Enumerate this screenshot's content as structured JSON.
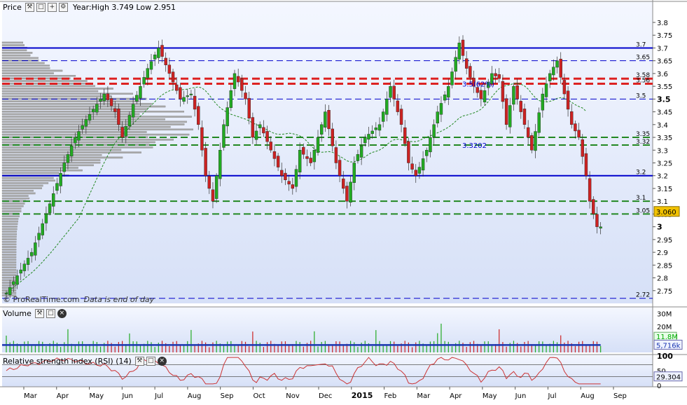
{
  "panels": {
    "price": {
      "title": "Price",
      "info": "Year:High 3.749 Low 2.951"
    },
    "volume": {
      "title": "Volume"
    },
    "rsi": {
      "title": "Relative strength index (RSI) (14)"
    }
  },
  "watermark": {
    "brand": "© ProRealTime.com",
    "note": "Data is end of day"
  },
  "icons": [
    "wrench-icon",
    "window-icon",
    "add-icon",
    "settings-icon",
    "close-icon"
  ],
  "colors": {
    "bull": "#22aa22",
    "bear": "#cc2222",
    "resistance": "#0000cc",
    "support": "#228822",
    "cluster": "#dd2222",
    "volume_ma": "#1a36b0",
    "rsi_line": "#cc3333",
    "last_price_bg": "#f2c200"
  },
  "chart_data": [
    {
      "type": "candlestick",
      "panel": "price",
      "x_labels": [
        "Mar",
        "Apr",
        "May",
        "Jun",
        "Jul",
        "Aug",
        "Sep",
        "Oct",
        "Nov",
        "Dec",
        "2015",
        "Feb",
        "Mar",
        "Apr",
        "May",
        "Jun",
        "Jul",
        "Aug",
        "Sep"
      ],
      "y_ticks": [
        2.75,
        2.8,
        2.85,
        2.9,
        2.95,
        3,
        3.05,
        3.1,
        3.15,
        3.2,
        3.25,
        3.3,
        3.35,
        3.4,
        3.45,
        3.5,
        3.55,
        3.6,
        3.65,
        3.7,
        3.75,
        3.8
      ],
      "ylim": [
        2.7,
        3.8
      ],
      "grid": false,
      "year_high": 3.749,
      "year_low": 2.951,
      "last_price": "3.060",
      "path_points": [
        [
          0,
          2.74
        ],
        [
          7,
          2.9
        ],
        [
          11,
          3.05
        ],
        [
          16,
          3.25
        ],
        [
          19,
          3.35
        ],
        [
          22,
          3.42
        ],
        [
          27,
          3.52
        ],
        [
          30,
          3.45
        ],
        [
          32,
          3.35
        ],
        [
          35,
          3.48
        ],
        [
          39,
          3.62
        ],
        [
          42,
          3.7
        ],
        [
          45,
          3.6
        ],
        [
          48,
          3.5
        ],
        [
          51,
          3.52
        ],
        [
          53,
          3.4
        ],
        [
          55,
          3.2
        ],
        [
          57,
          3.1
        ],
        [
          60,
          3.4
        ],
        [
          63,
          3.6
        ],
        [
          66,
          3.5
        ],
        [
          68,
          3.35
        ],
        [
          70,
          3.4
        ],
        [
          73,
          3.3
        ],
        [
          76,
          3.2
        ],
        [
          79,
          3.15
        ],
        [
          81,
          3.3
        ],
        [
          84,
          3.25
        ],
        [
          86,
          3.35
        ],
        [
          88,
          3.45
        ],
        [
          91,
          3.25
        ],
        [
          94,
          3.1
        ],
        [
          96,
          3.25
        ],
        [
          99,
          3.35
        ],
        [
          103,
          3.4
        ],
        [
          106,
          3.55
        ],
        [
          109,
          3.4
        ],
        [
          111,
          3.25
        ],
        [
          113,
          3.2
        ],
        [
          116,
          3.3
        ],
        [
          119,
          3.45
        ],
        [
          122,
          3.55
        ],
        [
          125,
          3.72
        ],
        [
          127,
          3.62
        ],
        [
          129,
          3.55
        ],
        [
          131,
          3.5
        ],
        [
          134,
          3.6
        ],
        [
          136,
          3.58
        ],
        [
          138,
          3.4
        ],
        [
          140,
          3.55
        ],
        [
          142,
          3.45
        ],
        [
          145,
          3.3
        ],
        [
          148,
          3.52
        ],
        [
          150,
          3.6
        ],
        [
          152,
          3.65
        ],
        [
          154,
          3.52
        ],
        [
          156,
          3.4
        ],
        [
          158,
          3.35
        ],
        [
          160,
          3.2
        ],
        [
          161,
          3.1
        ],
        [
          163,
          3.0
        ]
      ],
      "horizontal_levels": [
        {
          "value": 3.7,
          "label": "3.7",
          "style": "resistance"
        },
        {
          "value": 3.65,
          "label": "3.65",
          "style": "resistance-dash"
        },
        {
          "value": 3.58,
          "label": "3.58",
          "style": "cluster"
        },
        {
          "value": 3.56,
          "label": "3.56",
          "style": "cluster"
        },
        {
          "value": 3.5,
          "label": "3.5",
          "style": "resistance-dash"
        },
        {
          "value": 3.35,
          "label": "3.35",
          "style": "support"
        },
        {
          "value": 3.32,
          "label": "3.32",
          "style": "support"
        },
        {
          "value": 3.2,
          "label": "3.2",
          "style": "resistance"
        },
        {
          "value": 3.1,
          "label": "3.1",
          "style": "support"
        },
        {
          "value": 3.05,
          "label": "3.05",
          "style": "support"
        },
        {
          "value": 2.72,
          "label": "2.72",
          "style": "resistance-dash"
        }
      ],
      "annotations": [
        {
          "text": "3.5(62%)",
          "value": 3.56
        },
        {
          "text": "3.3202",
          "value": 3.32
        }
      ]
    },
    {
      "type": "bar",
      "panel": "volume",
      "y_ticks": [
        "30M",
        "20M",
        "10M"
      ],
      "ylim": [
        0,
        33
      ],
      "moving_average": 5.716,
      "last_value": 11.8,
      "readouts": [
        "11.8M",
        "5,716k"
      ]
    },
    {
      "type": "line",
      "panel": "rsi",
      "name": "RSI (14)",
      "y_ticks": [
        100,
        50,
        0
      ],
      "ylim": [
        0,
        100
      ],
      "last_value": 29.304,
      "readout": "29.304"
    }
  ]
}
